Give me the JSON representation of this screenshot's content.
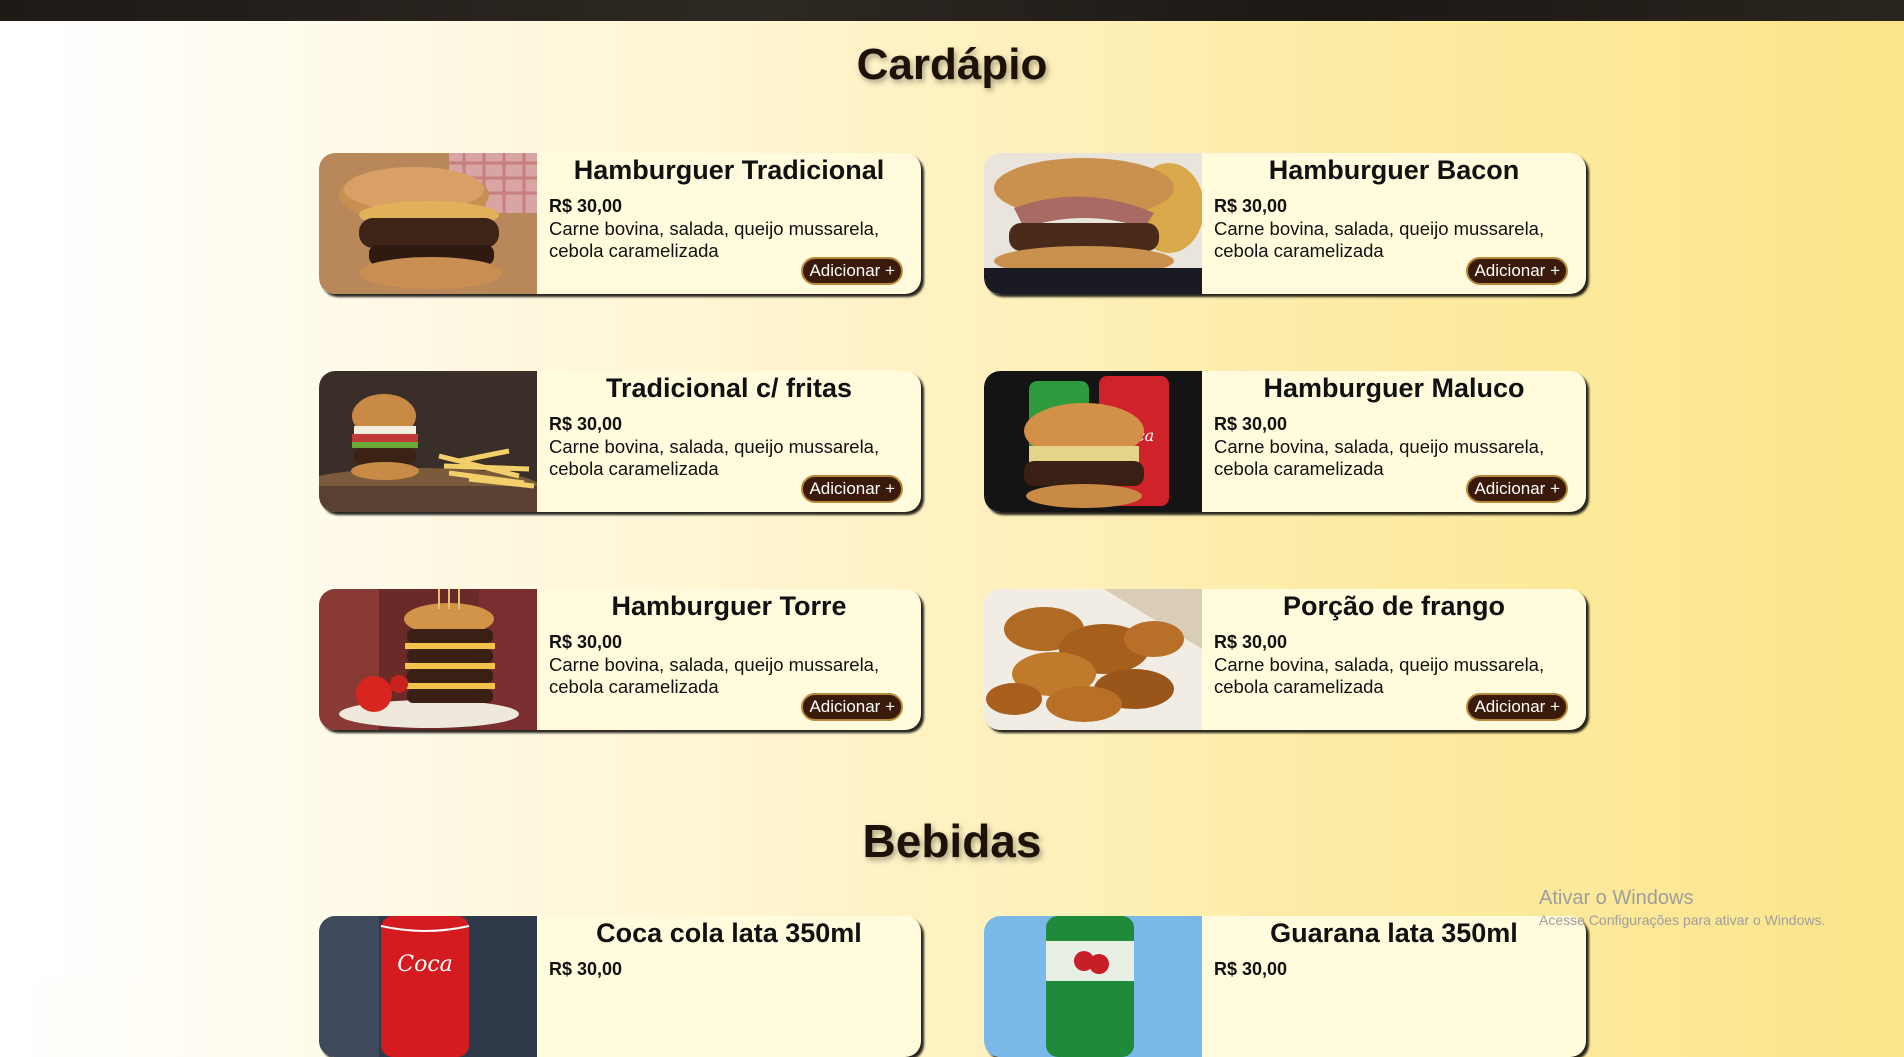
{
  "sections": {
    "menu_title": "Cardápio",
    "drinks_title": "Bebidas"
  },
  "menu_items": [
    {
      "name": "Hamburguer Tradicional",
      "price": "R$ 30,00",
      "description": "Carne bovina, salada, queijo mussarela, cebola caramelizada",
      "button": "Adicionar +",
      "image": "burger-caramelized-onion-photo"
    },
    {
      "name": "Hamburguer Bacon",
      "price": "R$ 30,00",
      "description": "Carne bovina, salada, queijo mussarela, cebola caramelizada",
      "button": "Adicionar +",
      "image": "burger-bacon-photo"
    },
    {
      "name": "Tradicional c/ fritas",
      "price": "R$ 30,00",
      "description": "Carne bovina, salada, queijo mussarela, cebola caramelizada",
      "button": "Adicionar +",
      "image": "burger-with-fries-photo"
    },
    {
      "name": "Hamburguer Maluco",
      "price": "R$ 30,00",
      "description": "Carne bovina, salada, queijo mussarela, cebola caramelizada",
      "button": "Adicionar +",
      "image": "burger-with-cans-photo"
    },
    {
      "name": "Hamburguer Torre",
      "price": "R$ 30,00",
      "description": "Carne bovina, salada, queijo mussarela, cebola caramelizada",
      "button": "Adicionar +",
      "image": "tower-burger-photo"
    },
    {
      "name": "Porção de frango",
      "price": "R$ 30,00",
      "description": "Carne bovina, salada, queijo mussarela, cebola caramelizada",
      "button": "Adicionar +",
      "image": "fried-chicken-photo"
    }
  ],
  "drink_items": [
    {
      "name": "Coca cola lata 350ml",
      "price": "R$ 30,00",
      "image": "coca-cola-can-photo"
    },
    {
      "name": "Guarana lata 350ml",
      "price": "R$ 30,00",
      "image": "guarana-can-photo"
    }
  ],
  "watermark": {
    "line1": "Ativar o Windows",
    "line2": "Acesse Configurações para ativar o Windows."
  },
  "colors": {
    "card_background": "#fffbdc",
    "button_background": "#3a1a0a",
    "button_border": "#b58a3a",
    "top_bar": "#1e1a16"
  }
}
